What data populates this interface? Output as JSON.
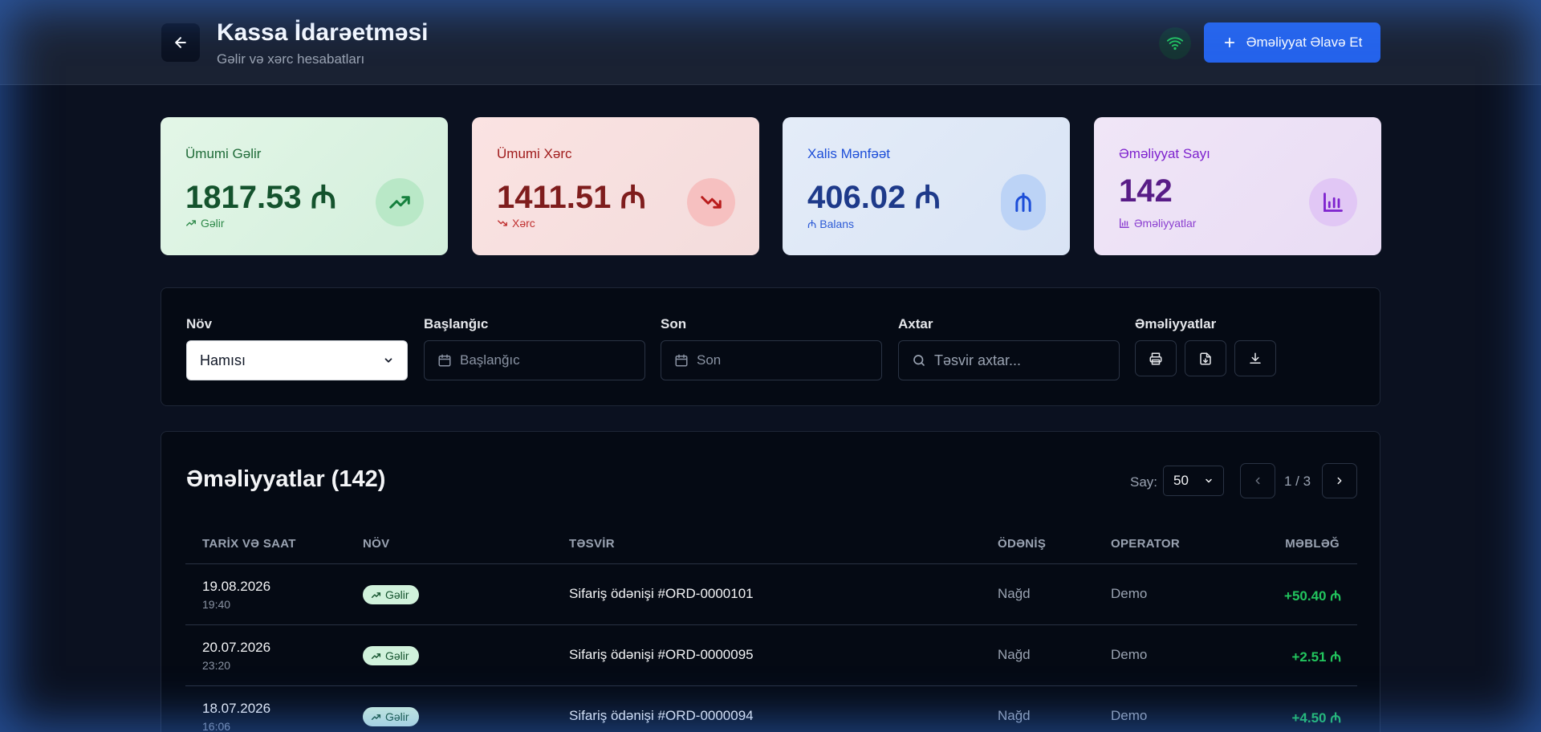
{
  "header": {
    "title": "Kassa İdarəetməsi",
    "subtitle": "Gəlir və xərc hesabatları",
    "add_button": "Əməliyyat Əlavə Et"
  },
  "stats": [
    {
      "label": "Ümumi Gəlir",
      "value": "1817.53 ₼",
      "sub": "Gəlir",
      "icon": "trending-up-icon"
    },
    {
      "label": "Ümumi Xərc",
      "value": "1411.51 ₼",
      "sub": "Xərc",
      "icon": "trending-down-icon"
    },
    {
      "label": "Xalis Mənfəət",
      "value": "406.02 ₼",
      "sub": "₼ Balans",
      "icon": "manat-icon"
    },
    {
      "label": "Əməliyyat Sayı",
      "value": "142",
      "sub": "Əməliyyatlar",
      "icon": "bar-chart-icon"
    }
  ],
  "filters": {
    "type_label": "Növ",
    "type_value": "Hamısı",
    "start_label": "Başlanğıc",
    "start_placeholder": "Başlanğıc",
    "end_label": "Son",
    "end_placeholder": "Son",
    "search_label": "Axtar",
    "search_placeholder": "Təsvir axtar...",
    "actions_label": "Əməliyyatlar"
  },
  "table": {
    "title": "Əməliyyatlar (142)",
    "per_page_label": "Say:",
    "per_page_value": "50",
    "page_text": "1 / 3",
    "columns": [
      "TARİX VƏ SAAT",
      "NÖV",
      "TƏSVİR",
      "ÖDƏNİŞ",
      "OPERATOR",
      "MƏBLƏĞ"
    ],
    "rows": [
      {
        "date": "19.08.2026",
        "time": "19:40",
        "type": "Gəlir",
        "desc": "Sifariş ödənişi #ORD-0000101",
        "payment": "Nağd",
        "operator": "Demo",
        "amount": "+50.40 ₼"
      },
      {
        "date": "20.07.2026",
        "time": "23:20",
        "type": "Gəlir",
        "desc": "Sifariş ödənişi #ORD-0000095",
        "payment": "Nağd",
        "operator": "Demo",
        "amount": "+2.51 ₼"
      },
      {
        "date": "18.07.2026",
        "time": "16:06",
        "type": "Gəlir",
        "desc": "Sifariş ödənişi #ORD-0000094",
        "payment": "Nağd",
        "operator": "Demo",
        "amount": "+4.50 ₼"
      }
    ]
  },
  "colors": {
    "accent": "#2563eb",
    "income": "#22c55e",
    "background": "#0b1120"
  }
}
